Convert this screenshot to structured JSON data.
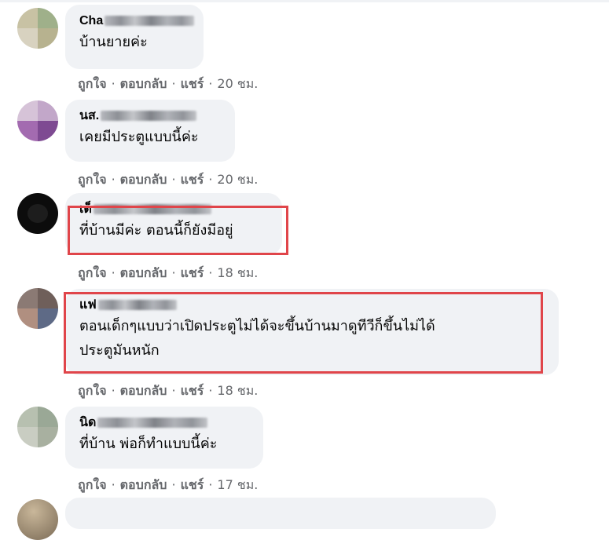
{
  "comments": [
    {
      "author_visible": "Cha",
      "text_lines": [
        "บ้านยายค่ะ"
      ],
      "like": "ถูกใจ",
      "reply": "ตอบกลับ",
      "share": "แชร์",
      "time": "20 ชม."
    },
    {
      "author_visible": "นส.",
      "text_lines": [
        "เคยมีประตูแบบนี้ค่ะ"
      ],
      "like": "ถูกใจ",
      "reply": "ตอบกลับ",
      "share": "แชร์",
      "time": "20 ชม."
    },
    {
      "author_visible": "เด็",
      "text_lines": [
        "ที่บ้านมีค่ะ ตอนนี้ก็ยังมีอยู่"
      ],
      "like": "ถูกใจ",
      "reply": "ตอบกลับ",
      "share": "แชร์",
      "time": "18 ชม."
    },
    {
      "author_visible": "แฟ",
      "text_lines": [
        "ตอนเด็กๆแบบว่าเปิดประตูไม่ได้จะขึ้นบ้านมาดูทีวีก็ขึ้นไม่ได้",
        "ประตูมันหนัก"
      ],
      "like": "ถูกใจ",
      "reply": "ตอบกลับ",
      "share": "แชร์",
      "time": "18 ชม."
    },
    {
      "author_visible": "นิด",
      "text_lines": [
        "ที่บ้าน พ่อก็ทำแบบนี้ค่ะ"
      ],
      "like": "ถูกใจ",
      "reply": "ตอบกลับ",
      "share": "แชร์",
      "time": "17 ชม."
    }
  ],
  "separator": "·",
  "colors": {
    "bubble": "#f0f2f5",
    "action_text": "#65676b",
    "highlight": "#e0454a"
  }
}
